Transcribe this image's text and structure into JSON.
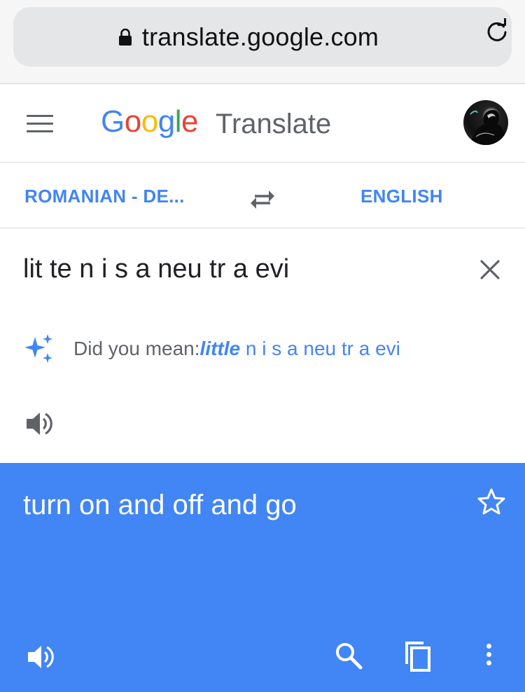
{
  "browser": {
    "url": "translate.google.com",
    "lock_icon": "lock-icon",
    "reload_icon": "reload-icon"
  },
  "header": {
    "logo": [
      "G",
      "o",
      "o",
      "g",
      "l",
      "e"
    ],
    "product": "Translate",
    "menu_icon": "hamburger-menu-icon",
    "avatar_icon": "user-avatar"
  },
  "languages": {
    "source": "ROMANIAN - DE...",
    "target": "ENGLISH",
    "swap_icon": "swap-arrows-icon"
  },
  "input": {
    "text": "lit te n i s a neu tr a evi",
    "clear_icon": "close-icon",
    "suggestion_prefix": "Did you mean: ",
    "suggestion_word": "little",
    "suggestion_rest": " n i s a neu tr a evi",
    "sparkle_icon": "sparkle-icon",
    "speaker_icon": "speaker-icon"
  },
  "output": {
    "text": "turn on and off and go",
    "star_icon": "star-outline-icon",
    "speaker_icon": "speaker-icon",
    "search_icon": "search-icon",
    "copy_icon": "copy-icon",
    "more_icon": "more-vert-icon"
  },
  "colors": {
    "accent": "#4285f4",
    "text": "#202124",
    "muted": "#5f6368",
    "output_bg": "#4285f4"
  }
}
